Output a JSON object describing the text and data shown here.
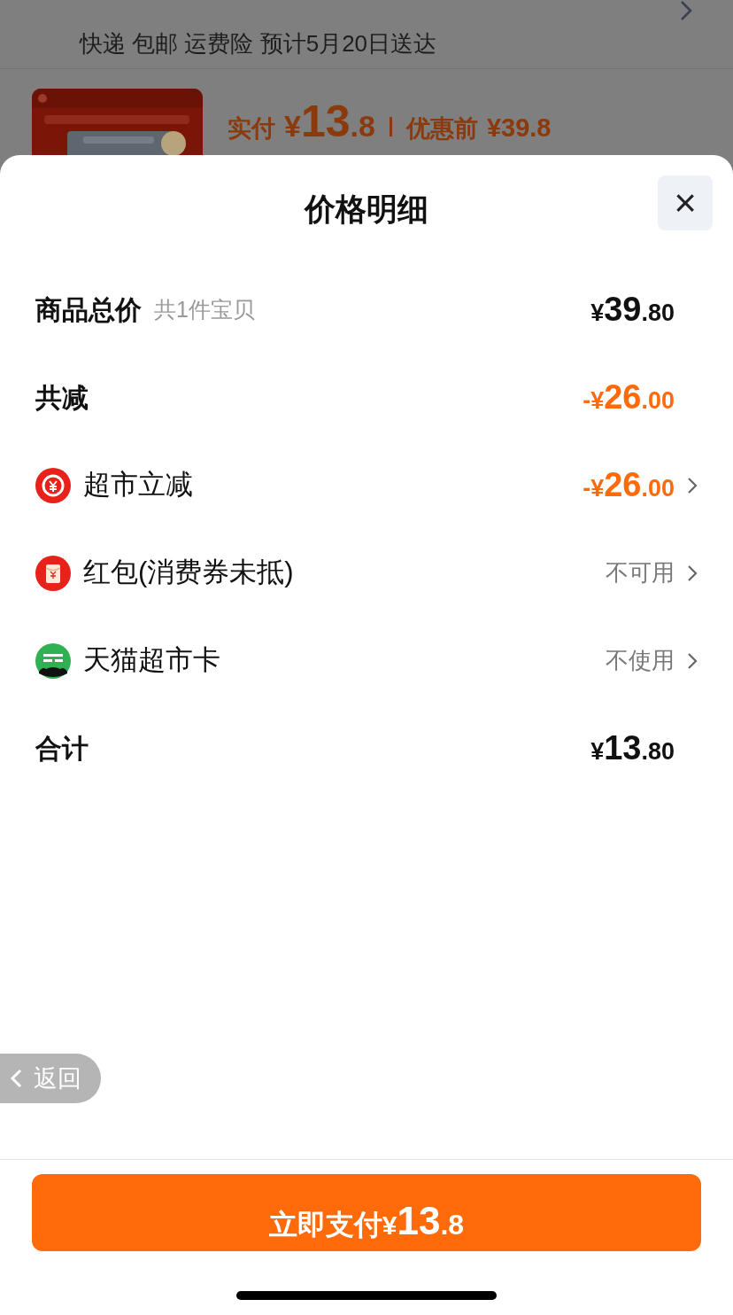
{
  "backdrop": {
    "delivery": "快递 包邮 运费险 预计5月20日送达",
    "paid_label": "实付",
    "paid_price": {
      "currency": "¥",
      "integer": "13",
      "decimal": ".8"
    },
    "original_label": "优惠前",
    "original_price": "¥39.8"
  },
  "sheet": {
    "title": "价格明细",
    "close": "×",
    "rows": [
      {
        "kind": "heading",
        "label": "商品总价",
        "note": "共1件宝贝",
        "price": {
          "color": "#111111",
          "currency": "¥",
          "integer": "39",
          "decimal": ".80"
        }
      },
      {
        "kind": "heading",
        "label": "共减",
        "price": {
          "color": "#ff6a0a",
          "sign": "-",
          "currency": "¥",
          "integer": "26",
          "decimal": ".00"
        }
      },
      {
        "kind": "option",
        "label": "超市立减",
        "price": {
          "color": "#ff6a0a",
          "sign": "-",
          "currency": "¥",
          "integer": "26",
          "decimal": ".00"
        }
      },
      {
        "kind": "option",
        "label": "红包(消费券未抵)",
        "status": "不可用"
      },
      {
        "kind": "option",
        "label": "天猫超市卡",
        "status": "不使用"
      },
      {
        "kind": "heading",
        "label": "合计",
        "price": {
          "color": "#111111",
          "currency": "¥",
          "integer": "13",
          "decimal": ".80"
        }
      }
    ]
  },
  "back_button": "返回",
  "pay_button": {
    "label": "立即支付",
    "currency": "¥",
    "integer": "13",
    "decimal": ".8"
  }
}
